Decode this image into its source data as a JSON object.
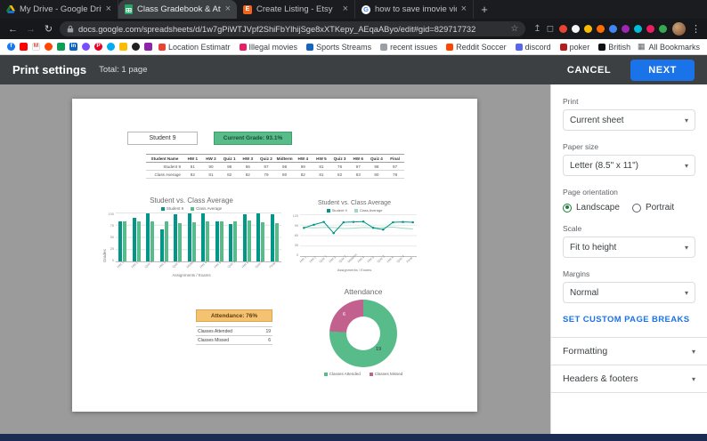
{
  "browser": {
    "tabs": [
      {
        "title": "My Drive - Google Drive",
        "icon": "drive",
        "active": false
      },
      {
        "title": "Class Gradebook & Attendance",
        "icon": "sheets",
        "active": true
      },
      {
        "title": "Create Listing - Etsy",
        "icon": "etsy",
        "active": false
      },
      {
        "title": "how to save imovie video - Go...",
        "icon": "google",
        "active": false
      }
    ],
    "new_tab_label": "+",
    "url": "docs.google.com/spreadsheets/d/1w7gPiWTJVpf2ShiFbYlhijSge8xXTKepy_AEqaAByo/edit#gid=829717732",
    "bookmark_favicons": [
      {
        "bg": "#1877f2",
        "fg": "#ffffff",
        "glyph": "f",
        "round": true
      },
      {
        "bg": "#ff0000",
        "fg": "#ffffff",
        "glyph": "",
        "round": false
      },
      {
        "bg": "#ffffff",
        "fg": "#ea4335",
        "glyph": "M",
        "round": false
      },
      {
        "bg": "#ff4500",
        "fg": "#ffffff",
        "glyph": "",
        "round": true
      },
      {
        "bg": "#0f9d58",
        "fg": "#ffffff",
        "glyph": "",
        "round": false
      },
      {
        "bg": "#0a66c2",
        "fg": "#ffffff",
        "glyph": "in",
        "round": false
      },
      {
        "bg": "#7c4dff",
        "fg": "#ffffff",
        "glyph": "",
        "round": true
      },
      {
        "bg": "#e60023",
        "fg": "#ffffff",
        "glyph": "P",
        "round": true
      },
      {
        "bg": "#00acee",
        "fg": "#ffffff",
        "glyph": "",
        "round": true
      },
      {
        "bg": "#fbbc04",
        "fg": "#ffffff",
        "glyph": "",
        "round": false
      },
      {
        "bg": "#212121",
        "fg": "#ffffff",
        "glyph": "",
        "round": true
      },
      {
        "bg": "#8e24aa",
        "fg": "#ffffff",
        "glyph": "",
        "round": false
      }
    ],
    "bookmarks": [
      {
        "label": "Location Estimatr",
        "color": "#ea4335"
      },
      {
        "label": "Illegal movies",
        "color": "#e91e63"
      },
      {
        "label": "Sports Streams",
        "color": "#1565c0"
      },
      {
        "label": "recent issues",
        "color": "#9aa0a6"
      },
      {
        "label": "Reddit Soccer",
        "color": "#ff4500"
      },
      {
        "label": "discord",
        "color": "#5865f2"
      },
      {
        "label": "poker",
        "color": "#b71c1c"
      },
      {
        "label": "British Pathé",
        "color": "#111111"
      }
    ],
    "all_bookmarks": "All Bookmarks",
    "extensions": [
      "#ea4335",
      "#f5f5f5",
      "#fbbc04",
      "#ff6d01",
      "#4285f4",
      "#9c27b0",
      "#00bcd4",
      "#e91e63",
      "#34a853"
    ]
  },
  "print_header": {
    "title": "Print settings",
    "total": "Total: 1 page",
    "cancel": "CANCEL",
    "next": "NEXT",
    "accent": "#1a73e8"
  },
  "settings": {
    "print_label": "Print",
    "print_value": "Current sheet",
    "paper_label": "Paper size",
    "paper_value": "Letter (8.5\" x 11\")",
    "orientation_label": "Page orientation",
    "landscape_label": "Landscape",
    "portrait_label": "Portrait",
    "scale_label": "Scale",
    "scale_value": "Fit to height",
    "margins_label": "Margins",
    "margins_value": "Normal",
    "page_breaks_label": "SET CUSTOM PAGE BREAKS",
    "formatting_label": "Formatting",
    "headers_footers_label": "Headers & footers",
    "radio_color": "#188038"
  },
  "preview": {
    "student_name": "Student 9",
    "grade_badge": "Current Grade: 93.1%",
    "grade_badge_color": "#57bb8a",
    "table": {
      "headers": [
        "Student Name",
        "HW 1",
        "HW 2",
        "Quiz 1",
        "HW 3",
        "Quiz 2",
        "Midterm",
        "HW 4",
        "HW 5",
        "Quiz 3",
        "HW 6",
        "Quiz 4",
        "Final"
      ],
      "rows": [
        [
          "Student 9",
          "81",
          "90",
          "98",
          "66",
          "97",
          "98",
          "99",
          "81",
          "76",
          "97",
          "98",
          "97"
        ],
        [
          "Class Average",
          "82",
          "81",
          "82",
          "82",
          "79",
          "80",
          "82",
          "81",
          "82",
          "83",
          "80",
          "78"
        ]
      ]
    },
    "attendance_badge": "Attendance: 76%",
    "attendance_badge_color": "#f5c271",
    "attendance_rows": [
      [
        "Classes Attended",
        "19"
      ],
      [
        "Classes Missed",
        "6"
      ]
    ],
    "chart_data": [
      {
        "type": "bar",
        "title": "Student vs. Class Average",
        "xlabel": "Assignments / Exams",
        "ylabel": "Grades",
        "ylim": [
          0,
          100
        ],
        "yticks": [
          100,
          75,
          50,
          25,
          0
        ],
        "categories": [
          "HW 1",
          "HW 2",
          "Quiz 1",
          "HW 3",
          "Quiz 2",
          "Midterm",
          "HW 4",
          "HW 5",
          "Quiz 3",
          "HW 6",
          "Quiz 4",
          "Final"
        ],
        "series": [
          {
            "name": "Student 9",
            "color": "#009688",
            "values": [
              81,
              90,
              98,
              66,
              97,
              98,
              99,
              81,
              76,
              97,
              98,
              97
            ]
          },
          {
            "name": "Class Average",
            "color": "#57bb8a",
            "values": [
              82,
              81,
              82,
              82,
              79,
              80,
              82,
              81,
              82,
              83,
              80,
              78
            ]
          }
        ]
      },
      {
        "type": "line",
        "title": "Student vs. Class Average",
        "xlabel": "Assignments / Exams",
        "ylim": [
          0,
          120
        ],
        "yticks": [
          120,
          90,
          60,
          30,
          0
        ],
        "categories": [
          "HW 1",
          "HW 2",
          "Quiz 1",
          "HW 3",
          "Quiz 2",
          "Midterm",
          "HW 4",
          "HW 5",
          "Quiz 3",
          "HW 6",
          "Quiz 4",
          "Final"
        ],
        "series": [
          {
            "name": "Student 9",
            "color": "#009688",
            "values": [
              81,
              90,
              98,
              66,
              97,
              98,
              99,
              81,
              76,
              97,
              98,
              97
            ]
          },
          {
            "name": "Class Average",
            "color": "#9fd8c0",
            "values": [
              82,
              81,
              82,
              82,
              79,
              80,
              82,
              81,
              82,
              83,
              80,
              78
            ]
          }
        ]
      },
      {
        "type": "pie",
        "title": "Attendance",
        "slices": [
          {
            "label": "Classes Attended",
            "value": 19,
            "color": "#57bb8a"
          },
          {
            "label": "Classes Missed",
            "value": 6,
            "color": "#c2608e"
          }
        ]
      }
    ]
  }
}
